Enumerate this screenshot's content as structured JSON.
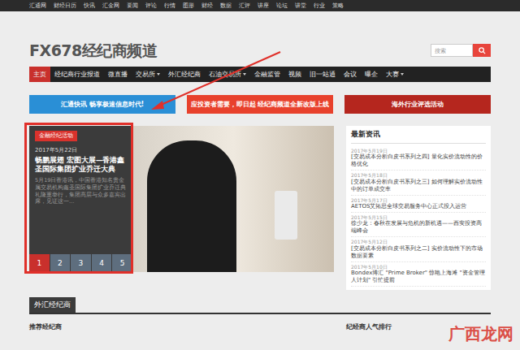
{
  "top_bar": {
    "items": [
      "汇通网",
      "财经日历",
      "快讯",
      "汇金网",
      "要闻",
      "评论",
      "行情",
      "图形",
      "财经",
      "数据",
      "汇评",
      "讲座",
      "论坛",
      "讲堂",
      "行业",
      "策略"
    ]
  },
  "header": {
    "title": "FX678经纪商频道",
    "search": {
      "placeholder": "搜索"
    }
  },
  "nav": {
    "items": [
      {
        "label": "主页",
        "selected": true,
        "dropdown": false
      },
      {
        "label": "经纪商行业报道",
        "selected": false,
        "dropdown": false
      },
      {
        "label": "微直播",
        "selected": false,
        "dropdown": false
      },
      {
        "label": "交易所",
        "selected": false,
        "dropdown": true
      },
      {
        "label": "外汇经纪商",
        "selected": false,
        "dropdown": false
      },
      {
        "label": "石油交易所",
        "selected": false,
        "dropdown": true
      },
      {
        "label": "金融监管",
        "selected": false,
        "dropdown": false
      },
      {
        "label": "视频",
        "selected": false,
        "dropdown": false
      },
      {
        "label": "旧一站通",
        "selected": false,
        "dropdown": false
      },
      {
        "label": "会议",
        "selected": false,
        "dropdown": false
      },
      {
        "label": "曝企",
        "selected": false,
        "dropdown": false
      },
      {
        "label": "大赛",
        "selected": false,
        "dropdown": true
      }
    ]
  },
  "banners": [
    {
      "text": "汇通快讯  畅享极速信息时代!",
      "color": "#2a8fd6"
    },
    {
      "text": "应投资者需要，即日起 经纪商频道全新改版上线",
      "color": "#e8412c"
    },
    {
      "text": "海外行业评选活动",
      "color": "#b5261e"
    }
  ],
  "slider": {
    "tag": "金融经纪活动",
    "date": "2017年5月22日",
    "title": "畅鹏展翅 宏图大展—香港鑫圣国际集团扩业乔迁大典",
    "summary": "5月19日香港讯，中国香港知名贵金属交易机构鑫圣国际集团扩业乔迁典礼隆重举行，集团高层与众多嘉宾出席，见证这一…",
    "pages": [
      {
        "label": "1",
        "selected": true
      },
      {
        "label": "2",
        "selected": false
      },
      {
        "label": "3",
        "selected": false
      },
      {
        "label": "4",
        "selected": false
      },
      {
        "label": "5",
        "selected": false
      }
    ]
  },
  "news": {
    "title": "最新资讯",
    "items": [
      {
        "date": "2017年5月19日",
        "title": "[交易成本分析白皮书系列之四] 量化实价流动性的价格优化"
      },
      {
        "date": "2017年5月18日",
        "title": "[交易成本分析白皮书系列之三] 如何理解实价流动性中的订单成交率"
      },
      {
        "date": "2017年5月17日",
        "title": "AETOS艾拓思全球交易服务中心正式投入运营"
      },
      {
        "date": "2017年5月15日",
        "title": "徐少龙：春秋在发展与危机的新机遇——西安投资高端峰会"
      },
      {
        "date": "2017年5月12日",
        "title": "[交易成本分析白皮书系列之二] 实价流动性下的市场数据要素"
      },
      {
        "date": "2017年5月10日",
        "title": "Bondex博汇 \"Prime Broker\" 惊艳上海滩 \"资金管理人计划\" 引忙提前"
      }
    ]
  },
  "section": {
    "title": "外汇经纪商",
    "columns": [
      "推荐经纪商",
      "纪经商人气排行"
    ]
  },
  "watermark": "广西龙网"
}
